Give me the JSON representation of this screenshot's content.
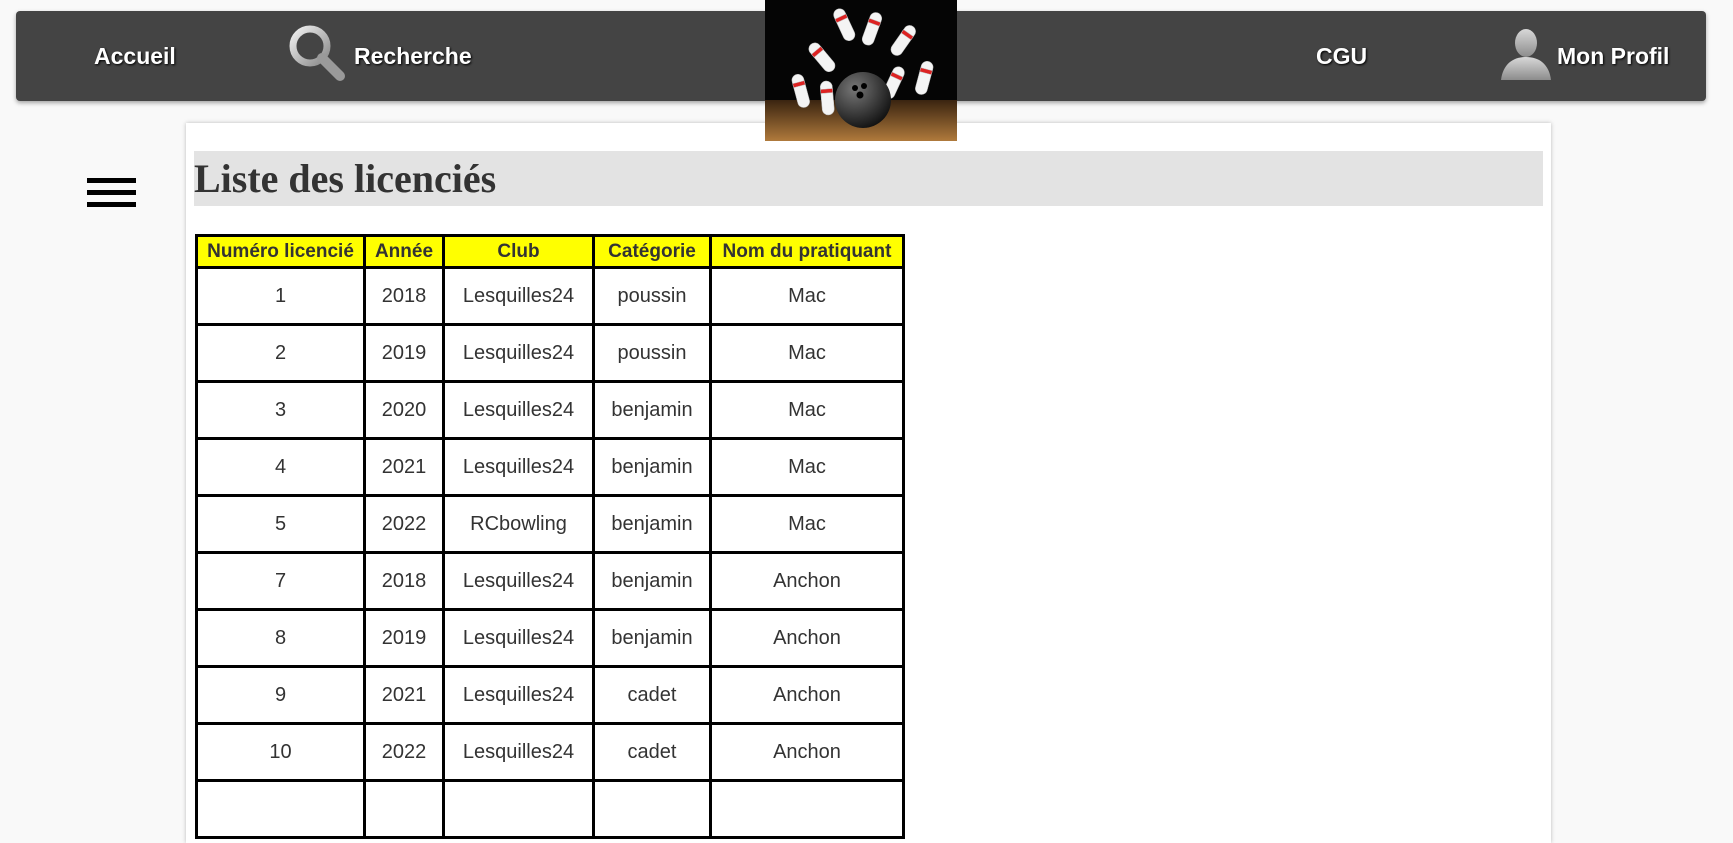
{
  "navbar": {
    "home_label": "Accueil",
    "search_label": "Recherche",
    "cgu_label": "CGU",
    "profile_label": "Mon Profil",
    "background": "#444444"
  },
  "page": {
    "title": "Liste des licenciés"
  },
  "table": {
    "headers": [
      "Numéro licencié",
      "Année",
      "Club",
      "Catégorie",
      "Nom du pratiquant"
    ],
    "header_color": "#ffff00",
    "rows": [
      [
        "1",
        "2018",
        "Lesquilles24",
        "poussin",
        "Mac"
      ],
      [
        "2",
        "2019",
        "Lesquilles24",
        "poussin",
        "Mac"
      ],
      [
        "3",
        "2020",
        "Lesquilles24",
        "benjamin",
        "Mac"
      ],
      [
        "4",
        "2021",
        "Lesquilles24",
        "benjamin",
        "Mac"
      ],
      [
        "5",
        "2022",
        "RCbowling",
        "benjamin",
        "Mac"
      ],
      [
        "7",
        "2018",
        "Lesquilles24",
        "benjamin",
        "Anchon"
      ],
      [
        "8",
        "2019",
        "Lesquilles24",
        "benjamin",
        "Anchon"
      ],
      [
        "9",
        "2021",
        "Lesquilles24",
        "cadet",
        "Anchon"
      ],
      [
        "10",
        "2022",
        "Lesquilles24",
        "cadet",
        "Anchon"
      ],
      [
        "",
        "",
        "",
        "",
        ""
      ]
    ]
  },
  "icons": {
    "menu": "hamburger-menu-icon",
    "search": "magnifier-icon",
    "profile": "user-silhouette-icon",
    "logo": "bowling-pins-logo"
  }
}
